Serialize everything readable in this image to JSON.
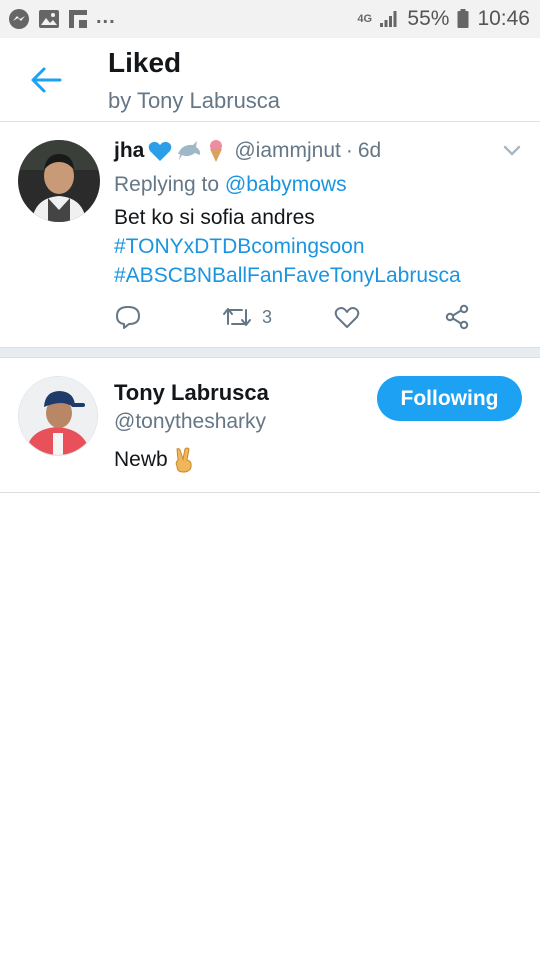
{
  "status_bar": {
    "battery": "55%",
    "time": "10:46",
    "network": "4G",
    "more": "...",
    "icons": [
      "messenger-icon",
      "gallery-icon",
      "flipboard-icon",
      "signal-icon",
      "battery-icon"
    ]
  },
  "header": {
    "title": "Liked",
    "subtitle": "by Tony Labrusca",
    "back_icon": "back-arrow-icon"
  },
  "tweet": {
    "name": "jha",
    "emojis": [
      "blue-heart",
      "dolphin",
      "ice-cream"
    ],
    "handle": "@iammjnut",
    "separator": "·",
    "time": "6d",
    "replying_prefix": "Replying to",
    "replying_to": "@babymows",
    "text": "Bet ko si sofia andres",
    "hashtags": [
      "#TONYxDTDBcomingsoon",
      "#ABSCBNBallFanFaveTonyLabrusca"
    ],
    "retweet_count": "3"
  },
  "user": {
    "name": "Tony Labrusca",
    "handle": "@tonythesharky",
    "bio": "Newb",
    "bio_emoji": "victory-hand",
    "follow_label": "Following"
  },
  "colors": {
    "accent": "#1da1f2",
    "link": "#1b95e0",
    "secondary_text": "#657786",
    "divider": "#e6ecf0"
  }
}
